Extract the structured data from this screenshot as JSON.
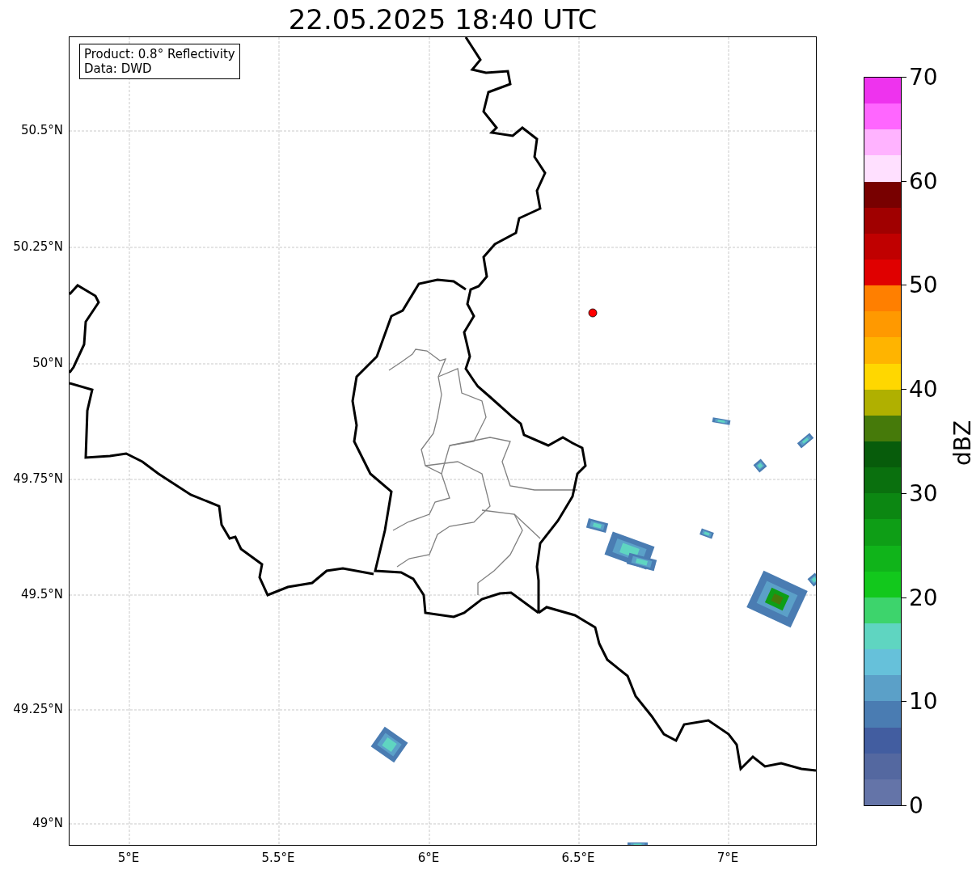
{
  "title": "22.05.2025 18:40 UTC",
  "info_box": [
    "Product: 0.8° Reflectivity",
    "Data: DWD"
  ],
  "y_ticks": [
    "50.5°N",
    "50.25°N",
    "50°N",
    "49.75°N",
    "49.5°N",
    "49.25°N",
    "49°N"
  ],
  "x_ticks": [
    "5°E",
    "5.5°E",
    "6°E",
    "6.5°E",
    "7°E"
  ],
  "colorbar": {
    "label": "dBZ",
    "ticks": [
      "70",
      "60",
      "50",
      "40",
      "30",
      "20",
      "10",
      "0"
    ],
    "segments": [
      {
        "color": "#ee33ee"
      },
      {
        "color": "#ff66ff"
      },
      {
        "color": "#ffb3ff"
      },
      {
        "color": "#ffe0ff"
      },
      {
        "color": "#780000"
      },
      {
        "color": "#a00000"
      },
      {
        "color": "#c00000"
      },
      {
        "color": "#e00000"
      },
      {
        "color": "#ff7f00"
      },
      {
        "color": "#ff9900"
      },
      {
        "color": "#ffb400"
      },
      {
        "color": "#ffd700"
      },
      {
        "color": "#b0b000"
      },
      {
        "color": "#467a0a"
      },
      {
        "color": "#075c0b"
      },
      {
        "color": "#0a700e"
      },
      {
        "color": "#0c8712"
      },
      {
        "color": "#0e9e16"
      },
      {
        "color": "#10b41a"
      },
      {
        "color": "#12c81c"
      },
      {
        "color": "#3dd46c"
      },
      {
        "color": "#5fd5c1"
      },
      {
        "color": "#66c1da"
      },
      {
        "color": "#5ba0c8"
      },
      {
        "color": "#4a7cb2"
      },
      {
        "color": "#425da0"
      },
      {
        "color": "#5468a0"
      },
      {
        "color": "#6474a8"
      }
    ]
  }
}
